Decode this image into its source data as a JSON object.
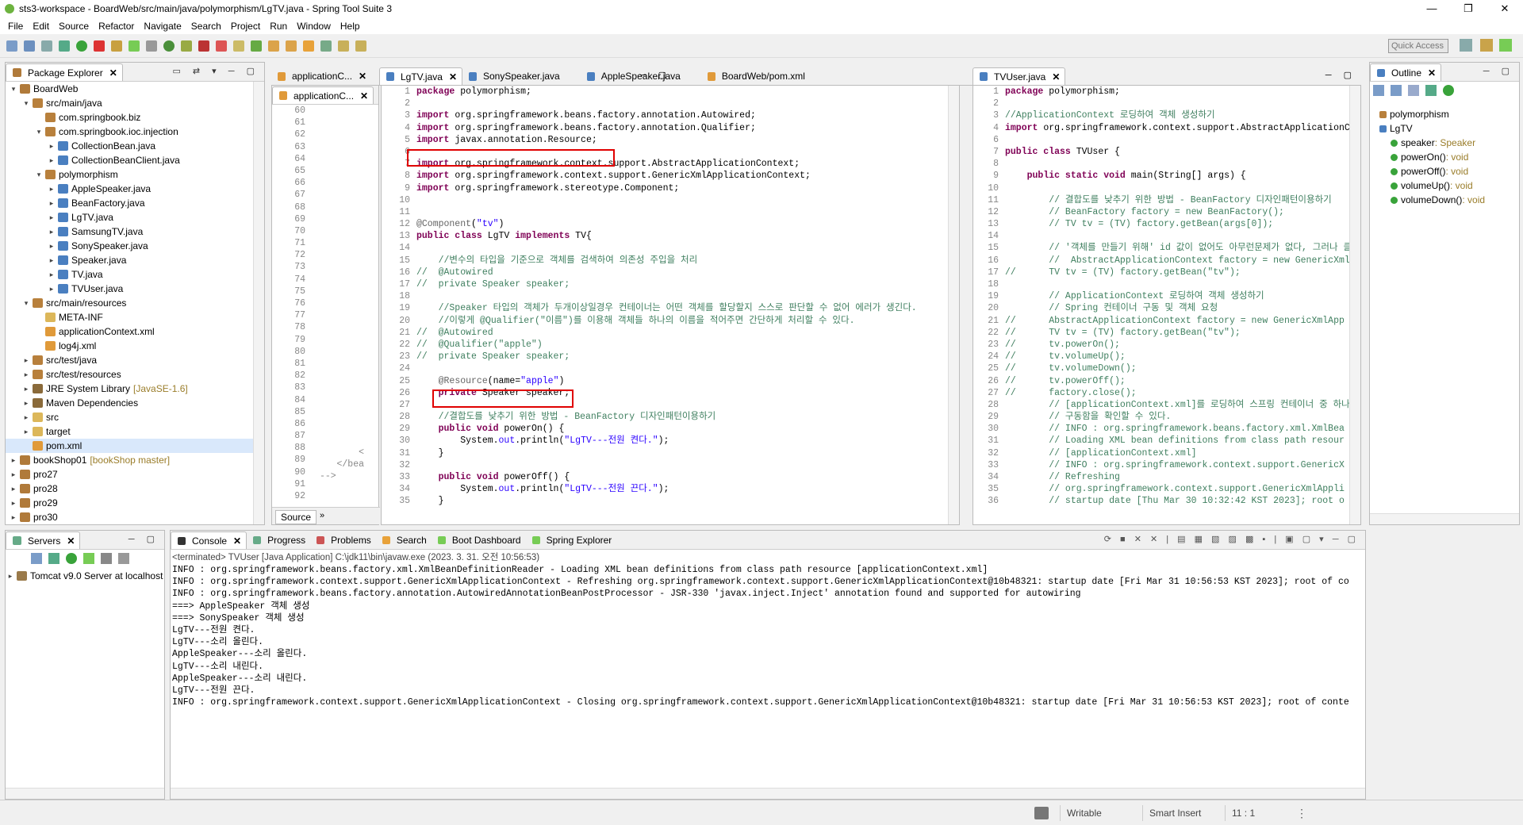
{
  "window": {
    "title": "sts3-workspace - BoardWeb/src/main/java/polymorphism/LgTV.java - Spring Tool Suite 3"
  },
  "menu": [
    "File",
    "Edit",
    "Source",
    "Refactor",
    "Navigate",
    "Search",
    "Project",
    "Run",
    "Window",
    "Help"
  ],
  "quick_access": "Quick Access",
  "package_explorer": {
    "tab": "Package Explorer",
    "items": [
      {
        "indent": 0,
        "tw": "▾",
        "icon": "proj",
        "label": "BoardWeb"
      },
      {
        "indent": 1,
        "tw": "▾",
        "icon": "pkg",
        "label": "src/main/java"
      },
      {
        "indent": 2,
        "tw": "",
        "icon": "pkg",
        "label": "com.springbook.biz"
      },
      {
        "indent": 2,
        "tw": "▾",
        "icon": "pkg",
        "label": "com.springbook.ioc.injection"
      },
      {
        "indent": 3,
        "tw": "▸",
        "icon": "java",
        "label": "CollectionBean.java"
      },
      {
        "indent": 3,
        "tw": "▸",
        "icon": "java",
        "label": "CollectionBeanClient.java"
      },
      {
        "indent": 2,
        "tw": "▾",
        "icon": "pkg",
        "label": "polymorphism"
      },
      {
        "indent": 3,
        "tw": "▸",
        "icon": "java",
        "label": "AppleSpeaker.java"
      },
      {
        "indent": 3,
        "tw": "▸",
        "icon": "java",
        "label": "BeanFactory.java"
      },
      {
        "indent": 3,
        "tw": "▸",
        "icon": "java",
        "label": "LgTV.java"
      },
      {
        "indent": 3,
        "tw": "▸",
        "icon": "java",
        "label": "SamsungTV.java"
      },
      {
        "indent": 3,
        "tw": "▸",
        "icon": "java",
        "label": "SonySpeaker.java"
      },
      {
        "indent": 3,
        "tw": "▸",
        "icon": "java",
        "label": "Speaker.java"
      },
      {
        "indent": 3,
        "tw": "▸",
        "icon": "java",
        "label": "TV.java"
      },
      {
        "indent": 3,
        "tw": "▸",
        "icon": "java",
        "label": "TVUser.java"
      },
      {
        "indent": 1,
        "tw": "▾",
        "icon": "pkg",
        "label": "src/main/resources"
      },
      {
        "indent": 2,
        "tw": "",
        "icon": "folder",
        "label": "META-INF"
      },
      {
        "indent": 2,
        "tw": "",
        "icon": "xml",
        "label": "applicationContext.xml"
      },
      {
        "indent": 2,
        "tw": "",
        "icon": "xml",
        "label": "log4j.xml"
      },
      {
        "indent": 1,
        "tw": "▸",
        "icon": "pkg",
        "label": "src/test/java"
      },
      {
        "indent": 1,
        "tw": "▸",
        "icon": "pkg",
        "label": "src/test/resources"
      },
      {
        "indent": 1,
        "tw": "▸",
        "icon": "lib",
        "label": "JRE System Library",
        "suffix": "[JavaSE-1.6]"
      },
      {
        "indent": 1,
        "tw": "▸",
        "icon": "lib",
        "label": "Maven Dependencies"
      },
      {
        "indent": 1,
        "tw": "▸",
        "icon": "folder",
        "label": "src"
      },
      {
        "indent": 1,
        "tw": "▸",
        "icon": "folder",
        "label": "target"
      },
      {
        "indent": 1,
        "tw": "",
        "icon": "xml",
        "label": "pom.xml",
        "selected": true
      },
      {
        "indent": 0,
        "tw": "▸",
        "icon": "proj",
        "label": "bookShop01",
        "suffix": "[bookShop master]"
      },
      {
        "indent": 0,
        "tw": "▸",
        "icon": "proj",
        "label": "pro27"
      },
      {
        "indent": 0,
        "tw": "▸",
        "icon": "proj",
        "label": "pro28"
      },
      {
        "indent": 0,
        "tw": "▸",
        "icon": "proj",
        "label": "pro29"
      },
      {
        "indent": 0,
        "tw": "▸",
        "icon": "proj",
        "label": "pro30"
      }
    ]
  },
  "xml_editor": {
    "tab": "applicationC...",
    "line_numbers": [
      "60",
      "61",
      "62",
      "63",
      "64",
      "65",
      "66",
      "67",
      "68",
      "69",
      "70",
      "71",
      "72",
      "73",
      "74",
      "75",
      "76",
      "77",
      "78",
      "79",
      "80",
      "81",
      "82",
      "83",
      "84",
      "85",
      "86",
      "87",
      "88",
      "89",
      "90",
      "91",
      "92"
    ],
    "fragments": {
      "line89": "<",
      "line90": "</bea",
      "line91": "-->"
    },
    "bottom_tabs": [
      "Source"
    ]
  },
  "editor_tabs": [
    "LgTV.java",
    "SonySpeaker.java",
    "AppleSpeaker.java",
    "BoardWeb/pom.xml"
  ],
  "lgtv_code": [
    {
      "n": "1",
      "h": [
        {
          "c": "kw",
          "t": "package"
        },
        {
          "t": " polymorphism;"
        }
      ]
    },
    {
      "n": "2",
      "h": []
    },
    {
      "n": "3",
      "h": [
        {
          "c": "kw",
          "t": "import"
        },
        {
          "t": " org.springframework.beans.factory.annotation.Autowired;"
        }
      ]
    },
    {
      "n": "4",
      "h": [
        {
          "c": "kw",
          "t": "import"
        },
        {
          "t": " org.springframework.beans.factory.annotation.Qualifier;"
        }
      ]
    },
    {
      "n": "5",
      "h": [
        {
          "c": "kw",
          "t": "import"
        },
        {
          "t": " javax.annotation.Resource;"
        }
      ]
    },
    {
      "n": "6",
      "h": []
    },
    {
      "n": "7",
      "h": [
        {
          "c": "kw",
          "t": "import"
        },
        {
          "t": " org.springframework.context.support.AbstractApplicationContext;"
        }
      ]
    },
    {
      "n": "8",
      "h": [
        {
          "c": "kw",
          "t": "import"
        },
        {
          "t": " org.springframework.context.support.GenericXmlApplicationContext;"
        }
      ]
    },
    {
      "n": "9",
      "h": [
        {
          "c": "kw",
          "t": "import"
        },
        {
          "t": " org.springframework.stereotype.Component;"
        }
      ]
    },
    {
      "n": "10",
      "h": []
    },
    {
      "n": "11",
      "h": []
    },
    {
      "n": "12",
      "h": [
        {
          "c": "an",
          "t": "@Component"
        },
        {
          "t": "("
        },
        {
          "c": "st",
          "t": "\"tv\""
        },
        {
          "t": ")"
        }
      ]
    },
    {
      "n": "13",
      "h": [
        {
          "c": "kw",
          "t": "public class"
        },
        {
          "t": " LgTV "
        },
        {
          "c": "kw",
          "t": "implements"
        },
        {
          "t": " TV{"
        }
      ]
    },
    {
      "n": "14",
      "h": []
    },
    {
      "n": "15",
      "h": [
        {
          "c": "cm",
          "t": "    //변수의 타입을 기준으로 객체를 검색하여 의존성 주입을 처리"
        }
      ]
    },
    {
      "n": "16",
      "h": [
        {
          "c": "cm",
          "t": "//  @Autowired"
        }
      ]
    },
    {
      "n": "17",
      "h": [
        {
          "c": "cm",
          "t": "//  private Speaker speaker;"
        }
      ]
    },
    {
      "n": "18",
      "h": []
    },
    {
      "n": "19",
      "h": [
        {
          "c": "cm",
          "t": "    //Speaker 타입의 객체가 두개이상일경우 컨테이너는 어떤 객체를 할당할지 스스로 판단할 수 없어 에러가 생긴다."
        }
      ]
    },
    {
      "n": "20",
      "h": [
        {
          "c": "cm",
          "t": "    //이렇게 @Qualifier(\"이름\")를 이용해 객체들 하나의 이름을 적어주면 간단하게 처리할 수 있다."
        }
      ]
    },
    {
      "n": "21",
      "h": [
        {
          "c": "cm",
          "t": "//  @Autowired"
        }
      ]
    },
    {
      "n": "22",
      "h": [
        {
          "c": "cm",
          "t": "//  @Qualifier(\"apple\")"
        }
      ]
    },
    {
      "n": "23",
      "h": [
        {
          "c": "cm",
          "t": "//  private Speaker speaker;"
        }
      ]
    },
    {
      "n": "24",
      "h": []
    },
    {
      "n": "25",
      "h": [
        {
          "t": "    "
        },
        {
          "c": "an",
          "t": "@Resource"
        },
        {
          "t": "(name="
        },
        {
          "c": "st",
          "t": "\"apple\""
        },
        {
          "t": ")"
        }
      ]
    },
    {
      "n": "26",
      "h": [
        {
          "t": "    "
        },
        {
          "c": "kw",
          "t": "private"
        },
        {
          "t": " Speaker speaker;"
        }
      ]
    },
    {
      "n": "27",
      "h": []
    },
    {
      "n": "28",
      "h": [
        {
          "c": "cm",
          "t": "    //결합도를 낮추기 위한 방법 - BeanFactory 디자인패턴이용하기"
        }
      ]
    },
    {
      "n": "29",
      "h": [
        {
          "t": "    "
        },
        {
          "c": "kw",
          "t": "public void"
        },
        {
          "t": " powerOn() {"
        }
      ]
    },
    {
      "n": "30",
      "h": [
        {
          "t": "        System."
        },
        {
          "c": "st",
          "t": "out"
        },
        {
          "t": ".println("
        },
        {
          "c": "st",
          "t": "\"LgTV---전원 켠다.\""
        },
        {
          "t": ");"
        }
      ]
    },
    {
      "n": "31",
      "h": [
        {
          "t": "    }"
        }
      ]
    },
    {
      "n": "32",
      "h": []
    },
    {
      "n": "33",
      "h": [
        {
          "t": "    "
        },
        {
          "c": "kw",
          "t": "public void"
        },
        {
          "t": " powerOff() {"
        }
      ]
    },
    {
      "n": "34",
      "h": [
        {
          "t": "        System."
        },
        {
          "c": "st",
          "t": "out"
        },
        {
          "t": ".println("
        },
        {
          "c": "st",
          "t": "\"LgTV---전원 끈다.\""
        },
        {
          "t": ");"
        }
      ]
    },
    {
      "n": "35",
      "h": [
        {
          "t": "    }"
        }
      ]
    }
  ],
  "tvuser_tab": "TVUser.java",
  "tvuser_code": [
    {
      "n": "1",
      "h": [
        {
          "c": "kw",
          "t": "package"
        },
        {
          "t": " polymorphism;"
        }
      ]
    },
    {
      "n": "2",
      "h": []
    },
    {
      "n": "3",
      "h": [
        {
          "c": "cm",
          "t": "//ApplicationContext 로딩하여 객체 생성하기"
        }
      ]
    },
    {
      "n": "4",
      "h": [
        {
          "c": "kw",
          "t": "import"
        },
        {
          "t": " org.springframework.context.support.AbstractApplicationContext;"
        }
      ]
    },
    {
      "n": "6",
      "h": []
    },
    {
      "n": "7",
      "h": [
        {
          "c": "kw",
          "t": "public class"
        },
        {
          "t": " TVUser {"
        }
      ]
    },
    {
      "n": "8",
      "h": []
    },
    {
      "n": "9",
      "h": [
        {
          "t": "    "
        },
        {
          "c": "kw",
          "t": "public static void"
        },
        {
          "t": " main(String[] args) {"
        }
      ]
    },
    {
      "n": "10",
      "h": []
    },
    {
      "n": "11",
      "h": [
        {
          "c": "cm",
          "t": "        // 결합도를 낮추기 위한 방법 - BeanFactory 디자인패턴이용하기"
        }
      ]
    },
    {
      "n": "12",
      "h": [
        {
          "c": "cm",
          "t": "        // BeanFactory factory = new BeanFactory();"
        }
      ]
    },
    {
      "n": "13",
      "h": [
        {
          "c": "cm",
          "t": "        // TV tv = (TV) factory.getBean(args[0]);"
        }
      ]
    },
    {
      "n": "14",
      "h": []
    },
    {
      "n": "15",
      "h": [
        {
          "c": "cm",
          "t": "        // '객체를 만들기 위해' id 값이 없어도 아무런문제가 없다, 그러나 클라이언트"
        }
      ]
    },
    {
      "n": "16",
      "h": [
        {
          "c": "cm",
          "t": "        //  AbstractApplicationContext factory = new GenericXml"
        }
      ]
    },
    {
      "n": "17",
      "h": [
        {
          "c": "cm",
          "t": "//      TV tv = (TV) factory.getBean(\"tv\");"
        }
      ]
    },
    {
      "n": "18",
      "h": []
    },
    {
      "n": "19",
      "h": [
        {
          "c": "cm",
          "t": "        // ApplicationContext 로딩하여 객체 생성하기"
        }
      ]
    },
    {
      "n": "20",
      "h": [
        {
          "c": "cm",
          "t": "        // Spring 컨테이너 구동 및 객체 요청"
        }
      ]
    },
    {
      "n": "21",
      "h": [
        {
          "c": "cm",
          "t": "//      AbstractApplicationContext factory = new GenericXmlApp"
        }
      ]
    },
    {
      "n": "22",
      "h": [
        {
          "c": "cm",
          "t": "//      TV tv = (TV) factory.getBean(\"tv\");"
        }
      ]
    },
    {
      "n": "23",
      "h": [
        {
          "c": "cm",
          "t": "//      tv.powerOn();"
        }
      ]
    },
    {
      "n": "24",
      "h": [
        {
          "c": "cm",
          "t": "//      tv.volumeUp();"
        }
      ]
    },
    {
      "n": "25",
      "h": [
        {
          "c": "cm",
          "t": "//      tv.volumeDown();"
        }
      ]
    },
    {
      "n": "26",
      "h": [
        {
          "c": "cm",
          "t": "//      tv.powerOff();"
        }
      ]
    },
    {
      "n": "27",
      "h": [
        {
          "c": "cm",
          "t": "//      factory.close();"
        }
      ]
    },
    {
      "n": "28",
      "h": [
        {
          "c": "cm",
          "t": "        // [applicationContext.xml]를 로딩하여 스프링 컨테이너 중 하나인 G"
        }
      ]
    },
    {
      "n": "29",
      "h": [
        {
          "c": "cm",
          "t": "        // 구동함을 확인할 수 있다."
        }
      ]
    },
    {
      "n": "30",
      "h": [
        {
          "c": "cm",
          "t": "        // INFO : org.springframework.beans.factory.xml.XmlBea"
        }
      ]
    },
    {
      "n": "31",
      "h": [
        {
          "c": "cm",
          "t": "        // Loading XML bean definitions from class path resour"
        }
      ]
    },
    {
      "n": "32",
      "h": [
        {
          "c": "cm",
          "t": "        // [applicationContext.xml]"
        }
      ]
    },
    {
      "n": "33",
      "h": [
        {
          "c": "cm",
          "t": "        // INFO : org.springframework.context.support.GenericX"
        }
      ]
    },
    {
      "n": "34",
      "h": [
        {
          "c": "cm",
          "t": "        // Refreshing"
        }
      ]
    },
    {
      "n": "35",
      "h": [
        {
          "c": "cm",
          "t": "        // org.springframework.context.support.GenericXmlAppli"
        }
      ]
    },
    {
      "n": "36",
      "h": [
        {
          "c": "cm",
          "t": "        // startup date [Thu Mar 30 10:32:42 KST 2023]; root o"
        }
      ]
    }
  ],
  "outline": {
    "tab": "Outline",
    "items": [
      {
        "indent": 0,
        "label": "polymorphism",
        "suffix": ""
      },
      {
        "indent": 0,
        "label": "LgTV",
        "suffix": ""
      },
      {
        "indent": 1,
        "label": "speaker",
        "suffix": " : Speaker"
      },
      {
        "indent": 1,
        "label": "powerOn()",
        "suffix": " : void"
      },
      {
        "indent": 1,
        "label": "powerOff()",
        "suffix": " : void"
      },
      {
        "indent": 1,
        "label": "volumeUp()",
        "suffix": " : void"
      },
      {
        "indent": 1,
        "label": "volumeDown()",
        "suffix": " : void"
      }
    ]
  },
  "servers": {
    "tab": "Servers",
    "items": [
      "Tomcat v9.0 Server at localhost"
    ]
  },
  "console": {
    "tabs": [
      "Console",
      "Progress",
      "Problems",
      "Search",
      "Boot Dashboard",
      "Spring Explorer"
    ],
    "header": "<terminated> TVUser [Java Application] C:\\jdk11\\bin\\javaw.exe (2023. 3. 31. 오전 10:56:53)",
    "lines": [
      "INFO : org.springframework.beans.factory.xml.XmlBeanDefinitionReader - Loading XML bean definitions from class path resource [applicationContext.xml]",
      "INFO : org.springframework.context.support.GenericXmlApplicationContext - Refreshing org.springframework.context.support.GenericXmlApplicationContext@10b48321: startup date [Fri Mar 31 10:56:53 KST 2023]; root of co",
      "INFO : org.springframework.beans.factory.annotation.AutowiredAnnotationBeanPostProcessor - JSR-330 'javax.inject.Inject' annotation found and supported for autowiring",
      "===> AppleSpeaker 객체 생성",
      "===> SonySpeaker 객체 생성",
      "LgTV---전원 켠다.",
      "LgTV---소리 올린다.",
      "AppleSpeaker---소리 올린다.",
      "LgTV---소리 내린다.",
      "AppleSpeaker---소리 내린다.",
      "LgTV---전원 끈다.",
      "INFO : org.springframework.context.support.GenericXmlApplicationContext - Closing org.springframework.context.support.GenericXmlApplicationContext@10b48321: startup date [Fri Mar 31 10:56:53 KST 2023]; root of conte"
    ]
  },
  "status": {
    "writable": "Writable",
    "insert_mode": "Smart Insert",
    "position": "11 : 1"
  }
}
